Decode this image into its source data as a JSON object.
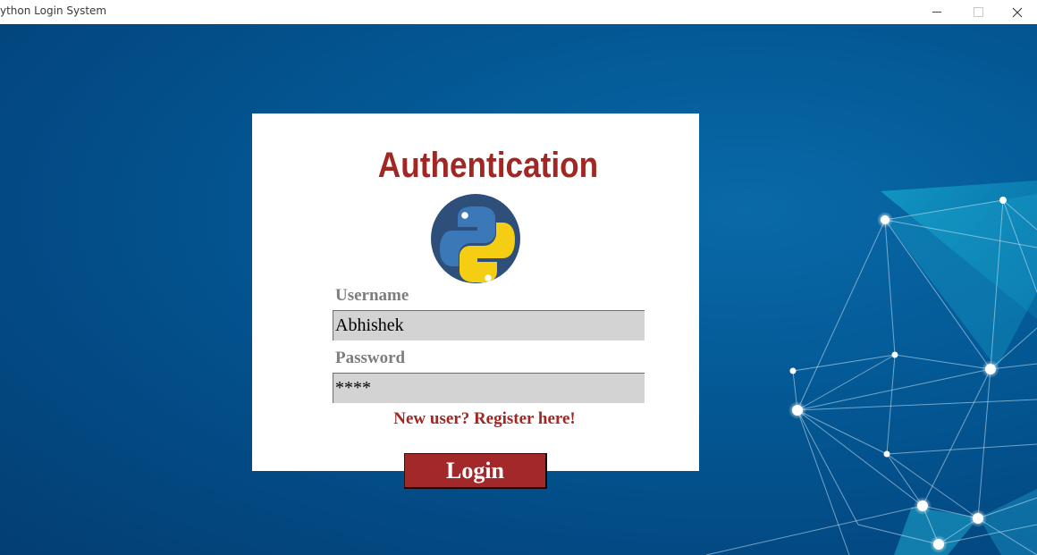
{
  "window": {
    "title": "ython Login System",
    "controls": {
      "minimize": "minimize-icon",
      "maximize": "maximize-icon",
      "close": "close-icon"
    }
  },
  "login": {
    "heading": "Authentication",
    "logo": "python-logo-icon",
    "username": {
      "label": "Username",
      "value": "Abhishek"
    },
    "password": {
      "label": "Password",
      "value": "****"
    },
    "register_link": "New user? Register here!",
    "login_button": "Login"
  },
  "colors": {
    "accent_red": "#a02723",
    "background_blue": "#035a96",
    "field_gray": "#d3d3d3",
    "label_gray": "#7d7d7d"
  }
}
